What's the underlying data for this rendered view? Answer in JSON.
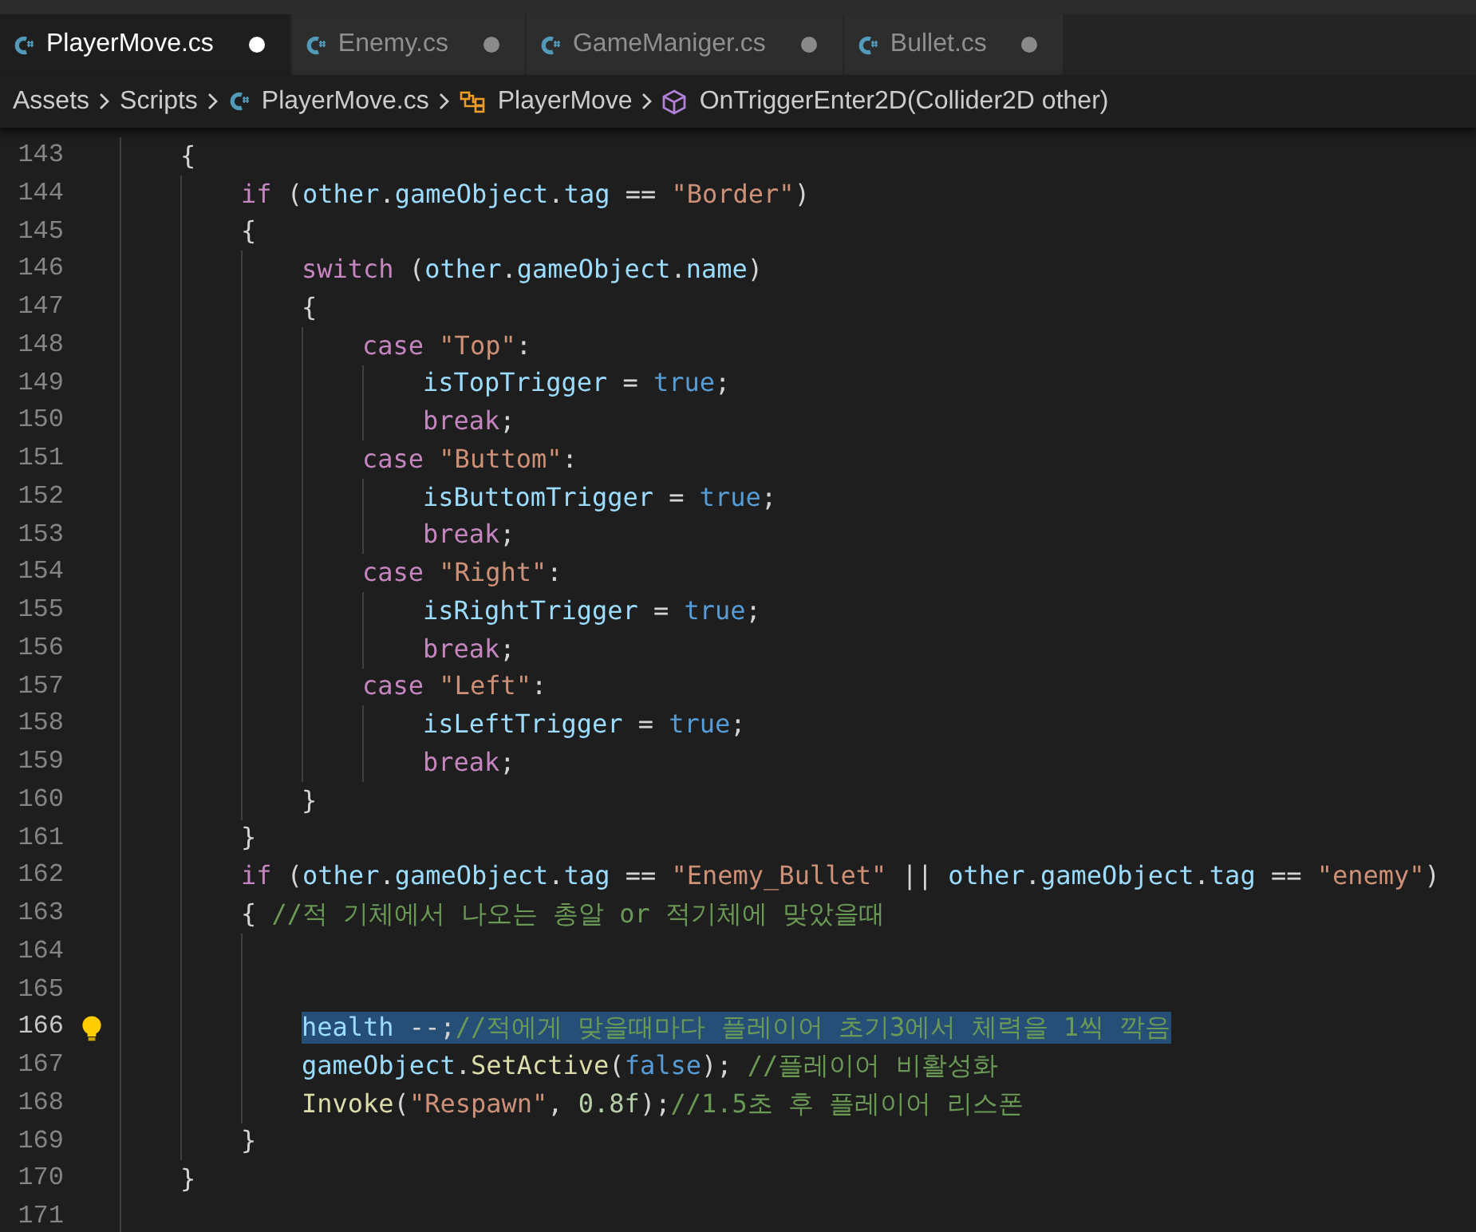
{
  "tabs": [
    {
      "label": "PlayerMove.cs",
      "selected": true,
      "modified": true
    },
    {
      "label": "Enemy.cs",
      "selected": false,
      "modified": true
    },
    {
      "label": "GameManiger.cs",
      "selected": false,
      "modified": true
    },
    {
      "label": "Bullet.cs",
      "selected": false,
      "modified": true
    }
  ],
  "breadcrumb": [
    {
      "kind": "folder",
      "label": "Assets"
    },
    {
      "kind": "folder",
      "label": "Scripts"
    },
    {
      "kind": "file",
      "label": "PlayerMove.cs"
    },
    {
      "kind": "class",
      "label": "PlayerMove"
    },
    {
      "kind": "method",
      "label": "OnTriggerEnter2D(Collider2D other)"
    }
  ],
  "lines": [
    {
      "number": "143",
      "current": false,
      "selected": false,
      "tokens": [
        {
          "kind": "plain",
          "text": "{"
        }
      ],
      "children": [
        {
          "number": "144",
          "current": false,
          "selected": false,
          "tokens": [
            {
              "kind": "control",
              "text": "if"
            },
            {
              "kind": "plain",
              "text": " ("
            },
            {
              "kind": "variable",
              "text": "other"
            },
            {
              "kind": "plain",
              "text": "."
            },
            {
              "kind": "variable",
              "text": "gameObject"
            },
            {
              "kind": "plain",
              "text": "."
            },
            {
              "kind": "variable",
              "text": "tag"
            },
            {
              "kind": "plain",
              "text": " == "
            },
            {
              "kind": "string",
              "text": "\"Border\""
            },
            {
              "kind": "plain",
              "text": ")"
            }
          ]
        },
        {
          "number": "145",
          "current": false,
          "selected": false,
          "tokens": [
            {
              "kind": "plain",
              "text": "{"
            }
          ],
          "children": [
            {
              "number": "146",
              "current": false,
              "selected": false,
              "tokens": [
                {
                  "kind": "control",
                  "text": "switch"
                },
                {
                  "kind": "plain",
                  "text": " ("
                },
                {
                  "kind": "variable",
                  "text": "other"
                },
                {
                  "kind": "plain",
                  "text": "."
                },
                {
                  "kind": "variable",
                  "text": "gameObject"
                },
                {
                  "kind": "plain",
                  "text": "."
                },
                {
                  "kind": "variable",
                  "text": "name"
                },
                {
                  "kind": "plain",
                  "text": ")"
                }
              ]
            },
            {
              "number": "147",
              "current": false,
              "selected": false,
              "tokens": [
                {
                  "kind": "plain",
                  "text": "{"
                }
              ],
              "children": [
                {
                  "number": "148",
                  "current": false,
                  "selected": false,
                  "tokens": [
                    {
                      "kind": "control",
                      "text": "case "
                    },
                    {
                      "kind": "string",
                      "text": "\"Top\""
                    },
                    {
                      "kind": "plain",
                      "text": ":"
                    }
                  ],
                  "children": [
                    {
                      "number": "149",
                      "current": false,
                      "selected": false,
                      "tokens": [
                        {
                          "kind": "variable",
                          "text": "isTopTrigger"
                        },
                        {
                          "kind": "plain",
                          "text": " = "
                        },
                        {
                          "kind": "keyword",
                          "text": "true"
                        },
                        {
                          "kind": "plain",
                          "text": ";"
                        }
                      ]
                    },
                    {
                      "number": "150",
                      "current": false,
                      "selected": false,
                      "tokens": [
                        {
                          "kind": "control",
                          "text": "break"
                        },
                        {
                          "kind": "plain",
                          "text": ";"
                        }
                      ]
                    }
                  ]
                },
                {
                  "number": "151",
                  "current": false,
                  "selected": false,
                  "tokens": [
                    {
                      "kind": "control",
                      "text": "case "
                    },
                    {
                      "kind": "string",
                      "text": "\"Buttom\""
                    },
                    {
                      "kind": "plain",
                      "text": ":"
                    }
                  ],
                  "children": [
                    {
                      "number": "152",
                      "current": false,
                      "selected": false,
                      "tokens": [
                        {
                          "kind": "variable",
                          "text": "isButtomTrigger"
                        },
                        {
                          "kind": "plain",
                          "text": " = "
                        },
                        {
                          "kind": "keyword",
                          "text": "true"
                        },
                        {
                          "kind": "plain",
                          "text": ";"
                        }
                      ]
                    },
                    {
                      "number": "153",
                      "current": false,
                      "selected": false,
                      "tokens": [
                        {
                          "kind": "control",
                          "text": "break"
                        },
                        {
                          "kind": "plain",
                          "text": ";"
                        }
                      ]
                    }
                  ]
                },
                {
                  "number": "154",
                  "current": false,
                  "selected": false,
                  "tokens": [
                    {
                      "kind": "control",
                      "text": "case "
                    },
                    {
                      "kind": "string",
                      "text": "\"Right\""
                    },
                    {
                      "kind": "plain",
                      "text": ":"
                    }
                  ],
                  "children": [
                    {
                      "number": "155",
                      "current": false,
                      "selected": false,
                      "tokens": [
                        {
                          "kind": "variable",
                          "text": "isRightTrigger"
                        },
                        {
                          "kind": "plain",
                          "text": " = "
                        },
                        {
                          "kind": "keyword",
                          "text": "true"
                        },
                        {
                          "kind": "plain",
                          "text": ";"
                        }
                      ]
                    },
                    {
                      "number": "156",
                      "current": false,
                      "selected": false,
                      "tokens": [
                        {
                          "kind": "control",
                          "text": "break"
                        },
                        {
                          "kind": "plain",
                          "text": ";"
                        }
                      ]
                    }
                  ]
                },
                {
                  "number": "157",
                  "current": false,
                  "selected": false,
                  "tokens": [
                    {
                      "kind": "control",
                      "text": "case "
                    },
                    {
                      "kind": "string",
                      "text": "\"Left\""
                    },
                    {
                      "kind": "plain",
                      "text": ":"
                    }
                  ],
                  "children": [
                    {
                      "number": "158",
                      "current": false,
                      "selected": false,
                      "tokens": [
                        {
                          "kind": "variable",
                          "text": "isLeftTrigger"
                        },
                        {
                          "kind": "plain",
                          "text": " = "
                        },
                        {
                          "kind": "keyword",
                          "text": "true"
                        },
                        {
                          "kind": "plain",
                          "text": ";"
                        }
                      ]
                    },
                    {
                      "number": "159",
                      "current": false,
                      "selected": false,
                      "tokens": [
                        {
                          "kind": "control",
                          "text": "break"
                        },
                        {
                          "kind": "plain",
                          "text": ";"
                        }
                      ]
                    }
                  ]
                }
              ]
            },
            {
              "number": "160",
              "current": false,
              "selected": false,
              "tokens": [
                {
                  "kind": "plain",
                  "text": "}"
                }
              ]
            }
          ]
        },
        {
          "number": "161",
          "current": false,
          "selected": false,
          "tokens": [
            {
              "kind": "plain",
              "text": "}"
            }
          ]
        },
        {
          "number": "162",
          "current": false,
          "selected": false,
          "tokens": [
            {
              "kind": "control",
              "text": "if"
            },
            {
              "kind": "plain",
              "text": " ("
            },
            {
              "kind": "variable",
              "text": "other"
            },
            {
              "kind": "plain",
              "text": "."
            },
            {
              "kind": "variable",
              "text": "gameObject"
            },
            {
              "kind": "plain",
              "text": "."
            },
            {
              "kind": "variable",
              "text": "tag"
            },
            {
              "kind": "plain",
              "text": " == "
            },
            {
              "kind": "string",
              "text": "\"Enemy_Bullet\""
            },
            {
              "kind": "plain",
              "text": " || "
            },
            {
              "kind": "variable",
              "text": "other"
            },
            {
              "kind": "plain",
              "text": "."
            },
            {
              "kind": "variable",
              "text": "gameObject"
            },
            {
              "kind": "plain",
              "text": "."
            },
            {
              "kind": "variable",
              "text": "tag"
            },
            {
              "kind": "plain",
              "text": " == "
            },
            {
              "kind": "string",
              "text": "\"enemy\""
            },
            {
              "kind": "plain",
              "text": ")"
            }
          ]
        },
        {
          "number": "163",
          "current": false,
          "selected": false,
          "tokens": [
            {
              "kind": "plain",
              "text": "{ "
            },
            {
              "kind": "comment",
              "text": "//적 기체에서 나오는 총알 or 적기체에 맞았을때"
            }
          ],
          "children": [
            {
              "number": "164",
              "current": false
            },
            {
              "number": "165",
              "current": false
            },
            {
              "number": "166",
              "current": true,
              "selected": true,
              "lightbulb": true,
              "tokens": [
                {
                  "kind": "variable",
                  "text": "health"
                },
                {
                  "kind": "plain",
                  "text": " --;"
                },
                {
                  "kind": "comment",
                  "text": "//적에게 맞을때마다 플레이어 초기3에서 체력을 1씩 깍음"
                }
              ]
            },
            {
              "number": "167",
              "current": false,
              "selected": false,
              "tokens": [
                {
                  "kind": "variable",
                  "text": "gameObject"
                },
                {
                  "kind": "plain",
                  "text": "."
                },
                {
                  "kind": "function",
                  "text": "SetActive"
                },
                {
                  "kind": "plain",
                  "text": "("
                },
                {
                  "kind": "keyword",
                  "text": "false"
                },
                {
                  "kind": "plain",
                  "text": "); "
                },
                {
                  "kind": "comment",
                  "text": "//플레이어 비활성화"
                }
              ]
            },
            {
              "number": "168",
              "current": false,
              "selected": false,
              "tokens": [
                {
                  "kind": "function",
                  "text": "Invoke"
                },
                {
                  "kind": "plain",
                  "text": "("
                },
                {
                  "kind": "string",
                  "text": "\"Respawn\""
                },
                {
                  "kind": "plain",
                  "text": ", "
                },
                {
                  "kind": "number",
                  "text": "0.8f"
                },
                {
                  "kind": "plain",
                  "text": ");"
                },
                {
                  "kind": "comment",
                  "text": "//1.5초 후 플레이어 리스폰"
                }
              ]
            }
          ]
        },
        {
          "number": "169",
          "current": false,
          "selected": false,
          "tokens": [
            {
              "kind": "plain",
              "text": "}"
            }
          ]
        }
      ]
    },
    {
      "number": "170",
      "current": false,
      "selected": false,
      "tokens": [
        {
          "kind": "plain",
          "text": "}"
        }
      ]
    },
    {
      "number": "171",
      "current": false
    }
  ]
}
